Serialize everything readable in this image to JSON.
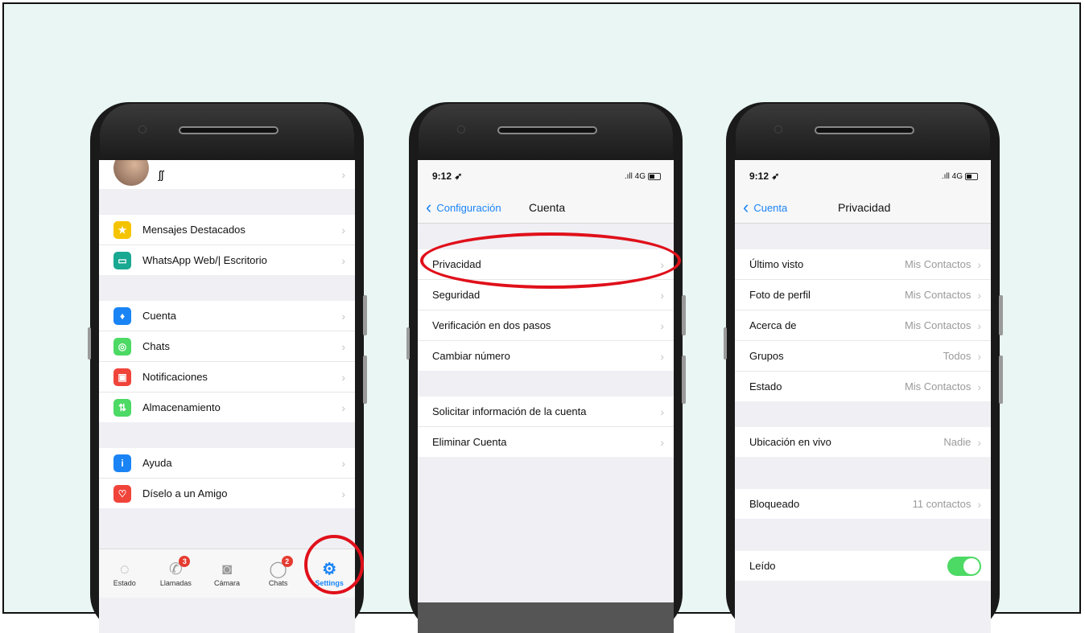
{
  "phone1": {
    "menu_group1": [
      {
        "label": "Mensajes Destacados",
        "icon": "star-icon",
        "color": "#f5c400",
        "glyph": "★"
      },
      {
        "label": "WhatsApp Web/| Escritorio",
        "icon": "laptop-icon",
        "color": "#19a891",
        "glyph": "▭"
      }
    ],
    "menu_group2": [
      {
        "label": "Cuenta",
        "icon": "key-icon",
        "color": "#1a84f5",
        "glyph": "♦"
      },
      {
        "label": "Chats",
        "icon": "whatsapp-icon",
        "color": "#4cd964",
        "glyph": "◎"
      },
      {
        "label": "Notificaciones",
        "icon": "notification-icon",
        "color": "#f0443a",
        "glyph": "▣"
      },
      {
        "label": "Almacenamiento",
        "icon": "storage-icon",
        "color": "#4cd964",
        "glyph": "⇅"
      }
    ],
    "menu_group3": [
      {
        "label": "Ayuda",
        "icon": "info-icon",
        "color": "#1a84f5",
        "glyph": "i"
      },
      {
        "label": "Díselo a un Amigo",
        "icon": "heart-icon",
        "color": "#f0443a",
        "glyph": "♡"
      }
    ],
    "tabs": [
      {
        "label": "Estado",
        "icon": "status-icon",
        "glyph": "◌"
      },
      {
        "label": "Llamadas",
        "icon": "phone-icon",
        "glyph": "✆",
        "badge": "3"
      },
      {
        "label": "Cámara",
        "icon": "camera-icon",
        "glyph": "◙"
      },
      {
        "label": "Chats",
        "icon": "chat-bubble-icon",
        "glyph": "◯",
        "badge": "2"
      },
      {
        "label": "Settings",
        "icon": "settings-icon",
        "glyph": "⚙",
        "active": true
      }
    ]
  },
  "phone2": {
    "time": "9:12 ➶",
    "signal": ".ıll 4G",
    "back_label": "Configuración",
    "title": "Cuenta",
    "group1": [
      "Privacidad",
      "Seguridad",
      "Verificación en dos pasos",
      "Cambiar número"
    ],
    "group2": [
      "Solicitar información de la cuenta",
      "Eliminar Cuenta"
    ]
  },
  "phone3": {
    "time": "9:12 ➶",
    "signal": ".ıll 4G",
    "back_label": "Cuenta",
    "title": "Privacidad",
    "group1": [
      {
        "label": "Último visto",
        "value": "Mis Contactos"
      },
      {
        "label": "Foto de perfil",
        "value": "Mis Contactos"
      },
      {
        "label": "Acerca de",
        "value": "Mis Contactos"
      },
      {
        "label": "Grupos",
        "value": "Todos"
      },
      {
        "label": "Estado",
        "value": "Mis Contactos"
      }
    ],
    "live_location": {
      "label": "Ubicación en vivo",
      "value": "Nadie"
    },
    "blocked": {
      "label": "Bloqueado",
      "value": "11 contactos"
    },
    "read_receipts": {
      "label": "Leído",
      "enabled": true
    }
  },
  "colors": {
    "accent": "#1a84f5",
    "highlight_circle": "#e0101a",
    "toggle_on": "#4cd964"
  }
}
